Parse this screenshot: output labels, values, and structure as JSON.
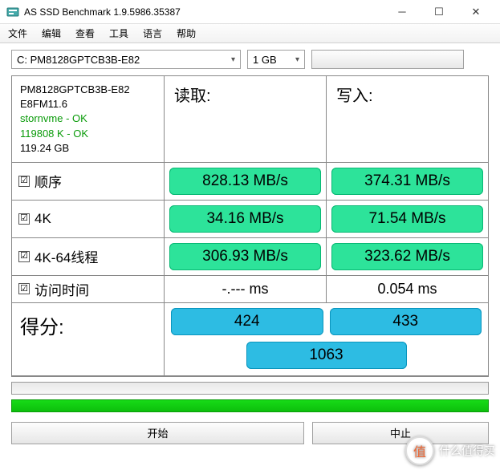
{
  "window": {
    "title": "AS SSD Benchmark 1.9.5986.35387"
  },
  "menu": {
    "file": "文件",
    "edit": "编辑",
    "view": "查看",
    "tools": "工具",
    "language": "语言",
    "help": "帮助"
  },
  "toolbar": {
    "drive": "C: PM8128GPTCB3B-E82",
    "size": "1 GB"
  },
  "info": {
    "model": "PM8128GPTCB3B-E82",
    "firmware": "E8FM11.6",
    "driver": "stornvme - OK",
    "alignment": "119808 K - OK",
    "capacity": "119.24 GB"
  },
  "headers": {
    "read": "读取:",
    "write": "写入:"
  },
  "rows": {
    "seq": {
      "label": "顺序",
      "checked": "☑",
      "read": "828.13 MB/s",
      "write": "374.31 MB/s"
    },
    "k4": {
      "label": "4K",
      "checked": "☑",
      "read": "34.16 MB/s",
      "write": "71.54 MB/s"
    },
    "k464": {
      "label": "4K-64线程",
      "checked": "☑",
      "read": "306.93 MB/s",
      "write": "323.62 MB/s"
    },
    "acc": {
      "label": "访问时间",
      "checked": "☑",
      "read": "-.--- ms",
      "write": "0.054 ms"
    }
  },
  "score": {
    "label": "得分:",
    "read": "424",
    "write": "433",
    "total": "1063"
  },
  "buttons": {
    "start": "开始",
    "abort": "中止"
  },
  "watermark": {
    "char": "值",
    "text": "什么值得买"
  },
  "colors": {
    "green": "#2de39a",
    "blue": "#2dbce3",
    "progress": "#0cbf0c"
  }
}
